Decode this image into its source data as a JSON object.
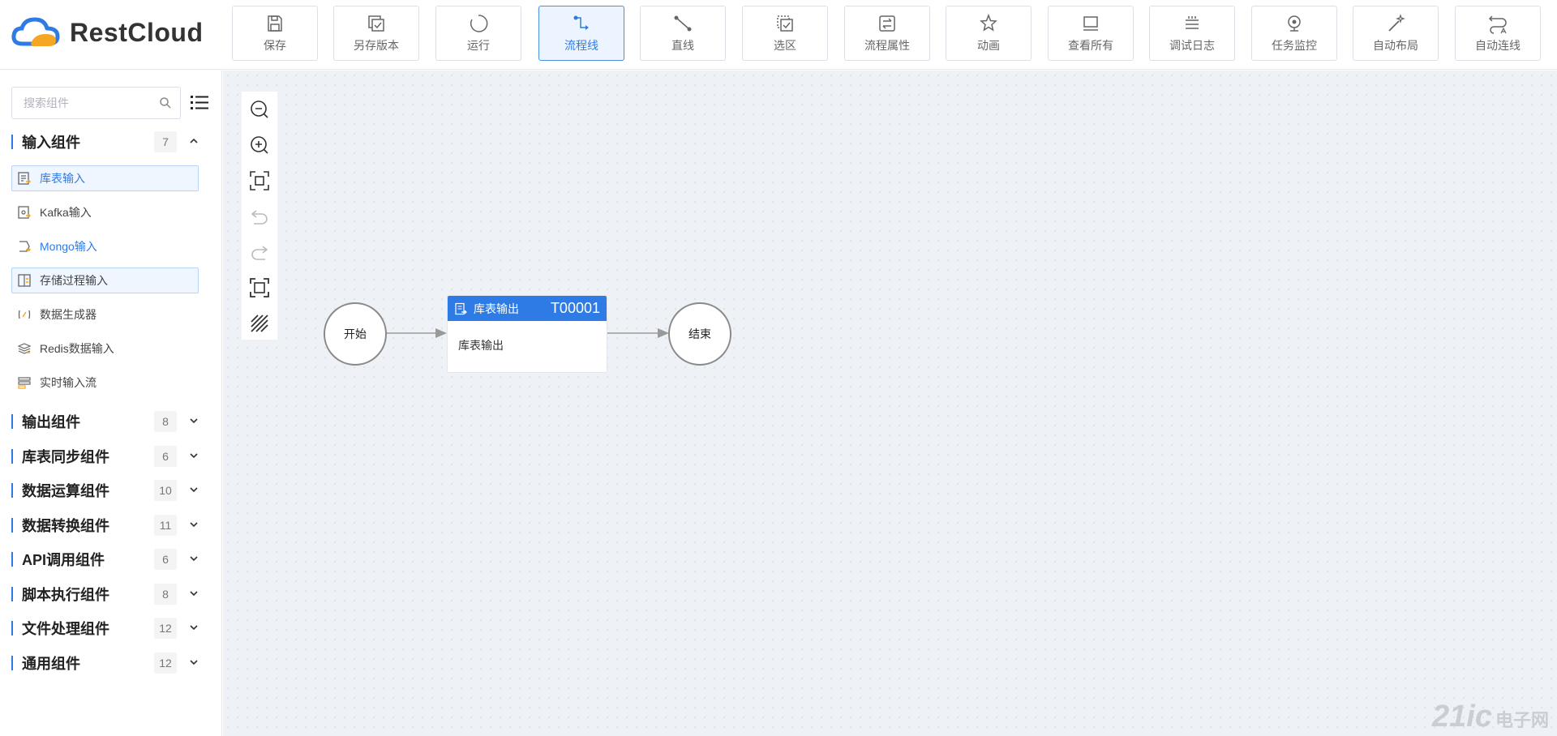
{
  "app": {
    "brand": "RestCloud"
  },
  "toolbar": [
    {
      "label": "保存",
      "icon": "save-icon"
    },
    {
      "label": "另存版本",
      "icon": "save-version-icon"
    },
    {
      "label": "运行",
      "icon": "run-icon"
    },
    {
      "label": "流程线",
      "icon": "flow-line-icon",
      "active": true
    },
    {
      "label": "直线",
      "icon": "straight-line-icon"
    },
    {
      "label": "选区",
      "icon": "select-area-icon"
    },
    {
      "label": "流程属性",
      "icon": "flow-properties-icon"
    },
    {
      "label": "动画",
      "icon": "animation-icon"
    },
    {
      "label": "查看所有",
      "icon": "view-all-icon"
    },
    {
      "label": "调试日志",
      "icon": "debug-log-icon"
    },
    {
      "label": "任务监控",
      "icon": "task-monitor-icon"
    },
    {
      "label": "自动布局",
      "icon": "auto-layout-icon"
    },
    {
      "label": "自动连线",
      "icon": "auto-connect-icon"
    }
  ],
  "sidebar": {
    "search_placeholder": "搜索组件",
    "groups": [
      {
        "title": "输入组件",
        "count": "7",
        "expanded": true,
        "items": [
          {
            "label": "库表输入"
          },
          {
            "label": "Kafka输入"
          },
          {
            "label": "Mongo输入"
          },
          {
            "label": "存储过程输入"
          },
          {
            "label": "数据生成器"
          },
          {
            "label": "Redis数据输入"
          },
          {
            "label": "实时输入流"
          }
        ]
      },
      {
        "title": "输出组件",
        "count": "8"
      },
      {
        "title": "库表同步组件",
        "count": "6"
      },
      {
        "title": "数据运算组件",
        "count": "10"
      },
      {
        "title": "数据转换组件",
        "count": "11"
      },
      {
        "title": "API调用组件",
        "count": "6"
      },
      {
        "title": "脚本执行组件",
        "count": "8"
      },
      {
        "title": "文件处理组件",
        "count": "12"
      },
      {
        "title": "通用组件",
        "count": "12"
      }
    ]
  },
  "canvas": {
    "start_label": "开始",
    "end_label": "结束",
    "task": {
      "name": "库表输出",
      "id": "T00001",
      "body": "库表输出"
    }
  },
  "colors": {
    "accent": "#2f7be5",
    "canvas_bg": "#eef1f6"
  },
  "watermark": {
    "main": "21ic",
    "sub": "电子网"
  }
}
